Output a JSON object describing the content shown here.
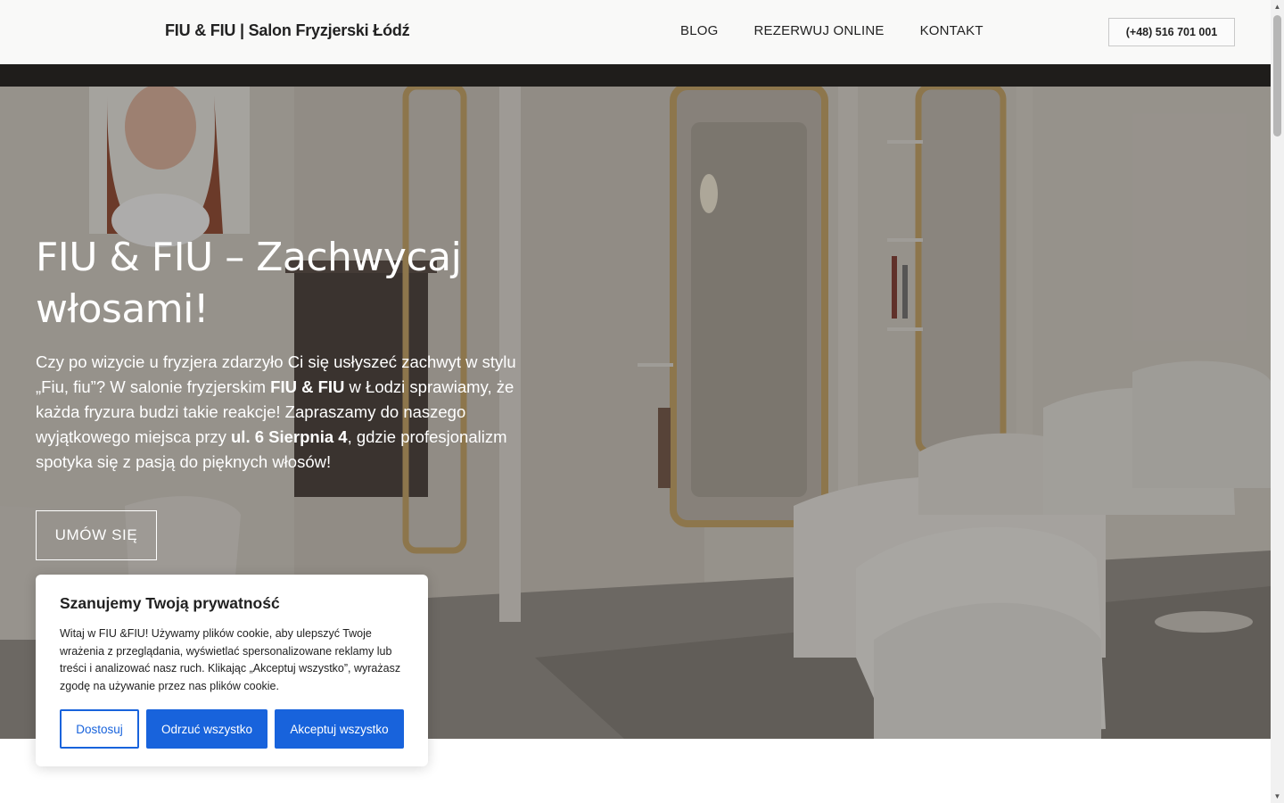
{
  "header": {
    "site_title": "FIU & FIU | Salon Fryzjerski Łódź",
    "nav": [
      "BLOG",
      "REZERWUJ ONLINE",
      "KONTAKT"
    ],
    "phone": "(+48) 516 701 001"
  },
  "hero": {
    "title": "FIU & FIU – Zachwycaj włosami!",
    "text_parts": [
      "Czy po wizycie u fryzjera zdarzyło Ci się usłyszeć zachwyt w stylu „Fiu, fiu”? W salonie fryzjerskim ",
      "FIU & FIU",
      " w Łodzi sprawiamy, że każda fryzura budzi takie reakcje! Zapraszamy do naszego wyjątkowego miejsca przy ",
      "ul. 6 Sierpnia 4",
      ", gdzie profesjonalizm spotyka się z pasją do pięknych włosów!"
    ],
    "cta_label": "UMÓW SIĘ"
  },
  "cookie": {
    "title": "Szanujemy Twoją prywatność",
    "text": "Witaj w FIU &FIU! Używamy plików cookie, aby ulepszyć Twoje wrażenia z przeglądania, wyświetlać spersonalizowane reklamy lub treści i analizować nasz ruch. Klikając „Akceptuj wszystko”, wyrażasz zgodę na używanie przez nas plików cookie.",
    "customize_label": "Dostosuj",
    "reject_label": "Odrzuć wszystko",
    "accept_label": "Akceptuj wszystko"
  },
  "scrollbar": {
    "up_icon": "triangle-up-icon",
    "down_icon": "triangle-down-icon"
  },
  "colors": {
    "accent": "#1863dc",
    "header_bg": "#f9f9f8",
    "dark_strip": "#1f1d1b"
  }
}
